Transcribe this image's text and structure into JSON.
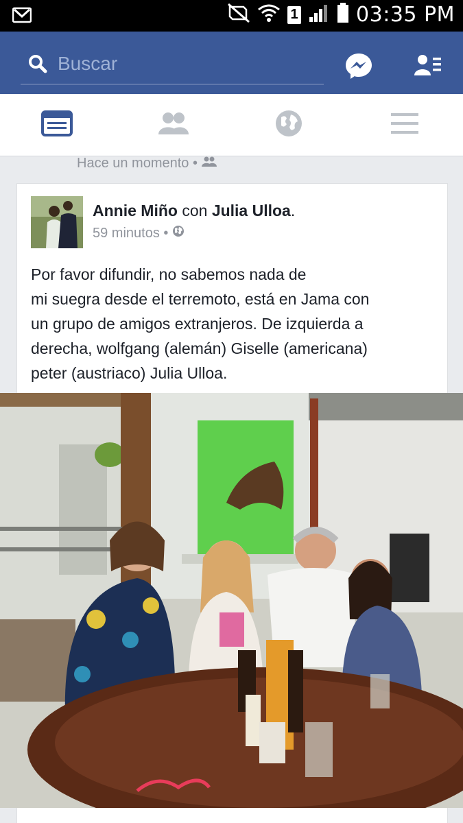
{
  "status_bar": {
    "time": "03:35 PM",
    "sim": "1"
  },
  "header": {
    "search_placeholder": "Buscar"
  },
  "tabs": [
    {
      "icon": "news-feed-icon",
      "active": true
    },
    {
      "icon": "friends-icon",
      "active": false
    },
    {
      "icon": "globe-icon",
      "active": false
    },
    {
      "icon": "menu-icon",
      "active": false
    }
  ],
  "previous_post": {
    "timestamp": "Hace un momento •"
  },
  "post": {
    "author": "Annie Miño",
    "with_word": "con",
    "tagged": "Julia Ulloa",
    "period": ".",
    "time": "59 minutos •",
    "text": "Por favor difundir, no sabemos nada de\nmi suegra  desde el terremoto, está en Jama con\nun grupo de amigos extranjeros. De izquierda a\nderecha, wolfgang (alemán) Giselle (americana)\npeter (austriaco) Julia Ulloa."
  },
  "colors": {
    "brand": "#3b5998",
    "active_tab": "#3b5998",
    "inactive_tab": "#bec3c9"
  }
}
